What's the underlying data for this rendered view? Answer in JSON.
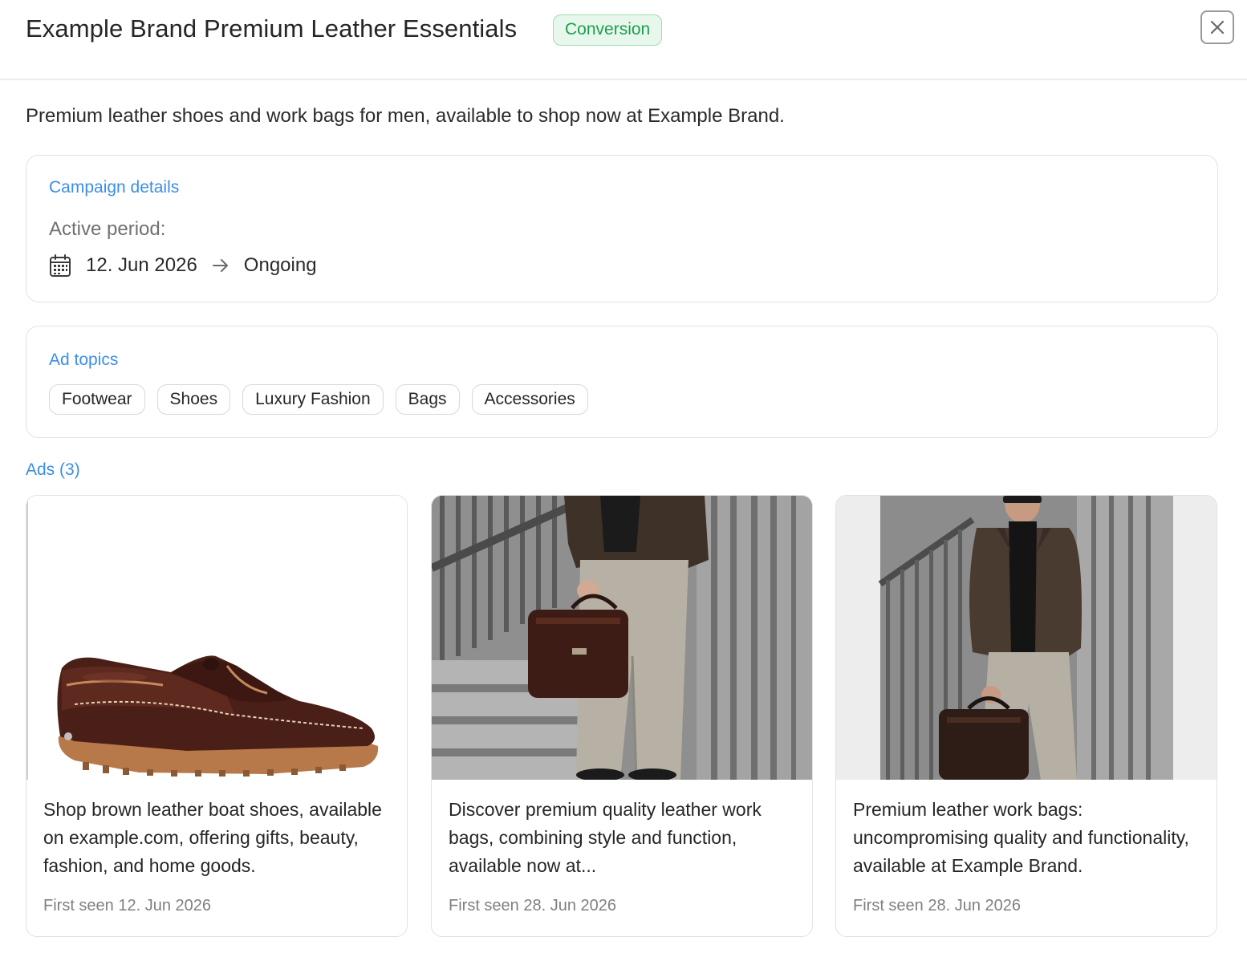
{
  "header": {
    "title": "Example Brand Premium Leather Essentials",
    "badge": "Conversion",
    "close_icon": "close-icon"
  },
  "description": "Premium leather shoes and work bags for men, available to shop now at Example Brand.",
  "campaign": {
    "section_title": "Campaign details",
    "period_label": "Active period:",
    "start": "12. Jun 2026",
    "end": "Ongoing",
    "calendar_icon": "calendar-icon",
    "arrow_icon": "arrow-right-icon"
  },
  "topics": {
    "section_title": "Ad topics",
    "items": [
      "Footwear",
      "Shoes",
      "Luxury Fashion",
      "Bags",
      "Accessories"
    ]
  },
  "ads": {
    "title": "Ads (3)",
    "items": [
      {
        "text": "Shop brown leather boat shoes, available on example.com, offering gifts, beauty, fashion, and home goods.",
        "first_seen": "First seen 12. Jun 2026",
        "image": "brown-leather-boat-shoe"
      },
      {
        "text": "Discover premium quality leather work bags, combining style and function, available now at...",
        "first_seen": "First seen 28. Jun 2026",
        "image": "man-holding-leather-bag-on-stairs"
      },
      {
        "text": "Premium leather work bags: uncompromising quality and functionality, available at Example Brand.",
        "first_seen": "First seen 28. Jun 2026",
        "image": "man-in-leather-jacket-with-bag"
      }
    ]
  },
  "colors": {
    "accent_link": "#3b8ee8",
    "badge_green": "#1e9e4e",
    "badge_bg": "#e7f7ec",
    "border": "#e2e2e2"
  }
}
